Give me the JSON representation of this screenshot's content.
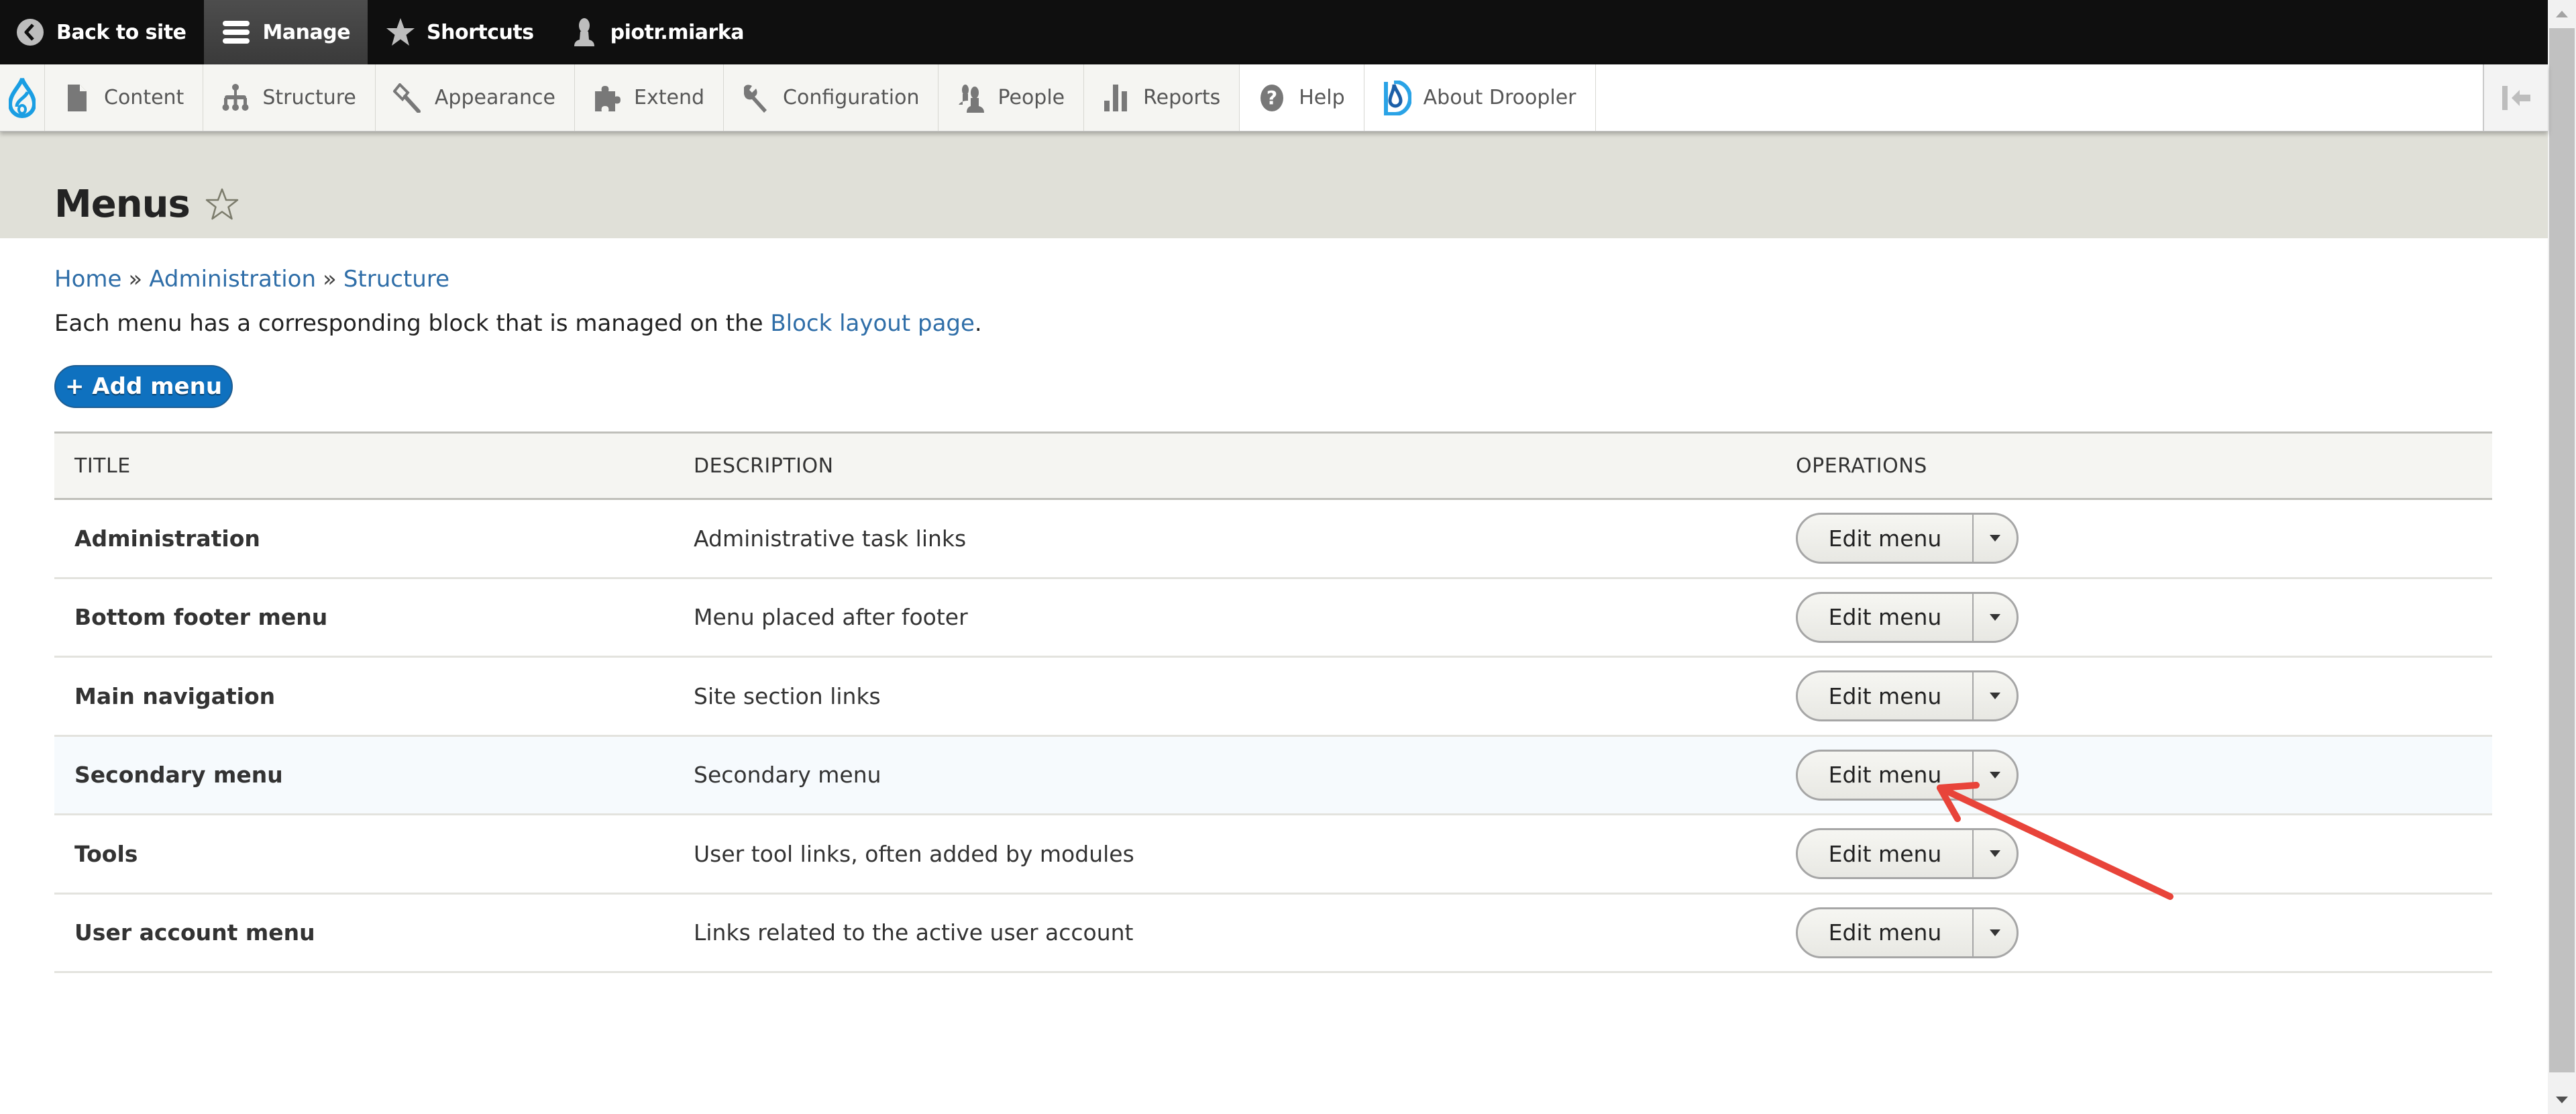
{
  "topbar": {
    "back_label": "Back to site",
    "manage_label": "Manage",
    "shortcuts_label": "Shortcuts",
    "user_label": "piotr.miarka"
  },
  "tray": {
    "items": [
      {
        "label": "Content",
        "icon": "file-icon"
      },
      {
        "label": "Structure",
        "icon": "sitemap-icon"
      },
      {
        "label": "Appearance",
        "icon": "paintbrush-icon"
      },
      {
        "label": "Extend",
        "icon": "puzzle-icon"
      },
      {
        "label": "Configuration",
        "icon": "wrench-icon"
      },
      {
        "label": "People",
        "icon": "people-icon"
      },
      {
        "label": "Reports",
        "icon": "bar-chart-icon"
      },
      {
        "label": "Help",
        "icon": "help-icon"
      },
      {
        "label": "About Droopler",
        "icon": "droopler-icon"
      }
    ]
  },
  "page": {
    "title": "Menus"
  },
  "breadcrumb": {
    "items": [
      "Home",
      "Administration",
      "Structure"
    ],
    "separator": "»"
  },
  "help_text": {
    "before": "Each menu has a corresponding block that is managed on the ",
    "link": "Block layout page",
    "after": "."
  },
  "actions": {
    "add_menu_label": "+ Add menu"
  },
  "table": {
    "headers": {
      "title": "TITLE",
      "description": "DESCRIPTION",
      "operations": "OPERATIONS"
    },
    "rows": [
      {
        "title": "Administration",
        "description": "Administrative task links",
        "operation": "Edit menu"
      },
      {
        "title": "Bottom footer menu",
        "description": "Menu placed after footer",
        "operation": "Edit menu"
      },
      {
        "title": "Main navigation",
        "description": "Site section links",
        "operation": "Edit menu"
      },
      {
        "title": "Secondary menu",
        "description": "Secondary menu",
        "operation": "Edit menu"
      },
      {
        "title": "Tools",
        "description": "User tool links, often added by modules",
        "operation": "Edit menu"
      },
      {
        "title": "User account menu",
        "description": "Links related to the active user account",
        "operation": "Edit menu"
      }
    ]
  },
  "colors": {
    "accent": "#0f71bf",
    "link": "#2f6ea8",
    "annotation": "#e8443a",
    "highlight_row": "#f6fafd"
  }
}
